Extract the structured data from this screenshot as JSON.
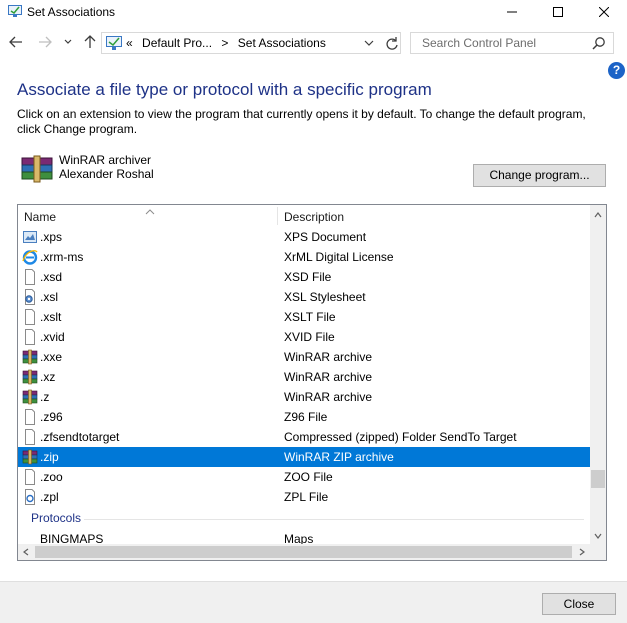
{
  "window": {
    "title": "Set Associations"
  },
  "address": {
    "crumbs": [
      "«",
      "Default Pro...",
      ">",
      "Set Associations"
    ],
    "search_placeholder": "Search Control Panel"
  },
  "help": {
    "label": "?"
  },
  "main": {
    "heading": "Associate a file type or protocol with a specific program",
    "description": "Click on an extension to view the program that currently opens it by default. To change the default program, click Change program.",
    "program_name": "WinRAR archiver",
    "program_publisher": "Alexander Roshal",
    "change_button": "Change program..."
  },
  "list": {
    "columns": {
      "name": "Name",
      "description": "Description"
    },
    "rows": [
      {
        "name": ".xps",
        "description": "XPS Document",
        "icon": "xps-document-icon"
      },
      {
        "name": ".xrm-ms",
        "description": "XrML Digital License",
        "icon": "internet-explorer-icon"
      },
      {
        "name": ".xsd",
        "description": "XSD File",
        "icon": "blank-file-icon"
      },
      {
        "name": ".xsl",
        "description": "XSL Stylesheet",
        "icon": "xsl-stylesheet-icon"
      },
      {
        "name": ".xslt",
        "description": "XSLT File",
        "icon": "blank-file-icon"
      },
      {
        "name": ".xvid",
        "description": "XVID File",
        "icon": "blank-file-icon"
      },
      {
        "name": ".xxe",
        "description": "WinRAR archive",
        "icon": "winrar-icon"
      },
      {
        "name": ".xz",
        "description": "WinRAR archive",
        "icon": "winrar-icon"
      },
      {
        "name": ".z",
        "description": "WinRAR archive",
        "icon": "winrar-icon"
      },
      {
        "name": ".z96",
        "description": "Z96 File",
        "icon": "blank-file-icon"
      },
      {
        "name": ".zfsendtotarget",
        "description": "Compressed (zipped) Folder SendTo Target",
        "icon": "blank-file-icon"
      },
      {
        "name": ".zip",
        "description": "WinRAR ZIP archive",
        "icon": "winrar-icon",
        "selected": true
      },
      {
        "name": ".zoo",
        "description": "ZOO File",
        "icon": "blank-file-icon"
      },
      {
        "name": ".zpl",
        "description": "ZPL File",
        "icon": "zpl-file-icon"
      }
    ],
    "group_label": "Protocols",
    "protocol_rows": [
      {
        "name": "BINGMAPS",
        "description": "Maps"
      }
    ]
  },
  "footer": {
    "close_button": "Close"
  },
  "colors": {
    "accent": "#0078d7",
    "heading": "#1e3287",
    "help": "#1c63c7"
  }
}
